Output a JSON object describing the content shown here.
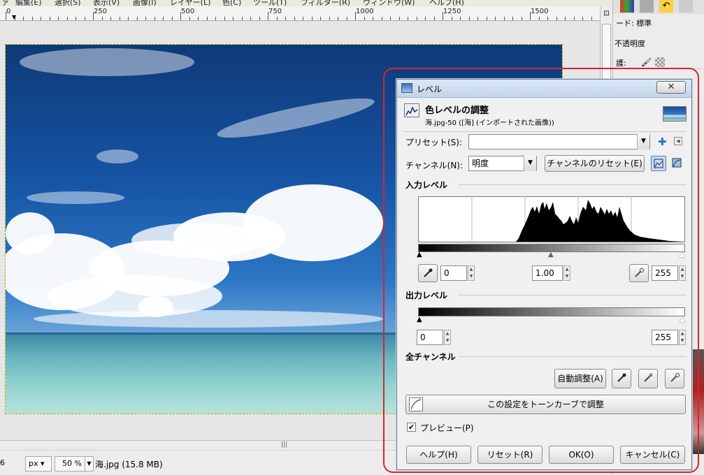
{
  "menu": [
    "ァ",
    "編集(E)",
    "選択(S)",
    "表示(V)",
    "画像(I)",
    "レイヤー(L)",
    "色(C)",
    "ツール(T)",
    "フィルター(R)",
    "ウィンドウ(W)",
    "ヘルプ(H)"
  ],
  "ruler": {
    "labels": [
      "0",
      "250",
      "500",
      "750",
      "1000",
      "1250",
      "1500"
    ]
  },
  "status": {
    "left_num": "6",
    "unit": "px",
    "zoom": "50 %",
    "filename": "海.jpg (15.8 MB)"
  },
  "dock": {
    "mode_label": "ード: 標準",
    "opacity_label": "不透明度",
    "lock_label": "護:"
  },
  "dialog": {
    "window_title": "レベル",
    "heading": "色レベルの調整",
    "subheading": "海.jpg-50 ([海] (インポートされた画像))",
    "preset_label": "プリセット(S):",
    "preset_value": "",
    "channel_label": "チャンネル(N):",
    "channel_value": "明度",
    "channel_reset": "チャンネルのリセット(E)",
    "input_levels": "入力レベル",
    "input_low": "0",
    "input_gamma": "1.00",
    "input_high": "255",
    "output_levels": "出力レベル",
    "output_low": "0",
    "output_high": "255",
    "all_channels": "全チャンネル",
    "auto_adjust": "自動調整(A)",
    "edit_curves": "この設定をトーンカーブで調整",
    "preview_label": "プレビュー(P)",
    "preview_checked": true,
    "help": "ヘルプ(H)",
    "reset": "リセット(R)",
    "ok": "OK(O)",
    "cancel": "キャンセル(C)",
    "close_symbol": "✕"
  }
}
